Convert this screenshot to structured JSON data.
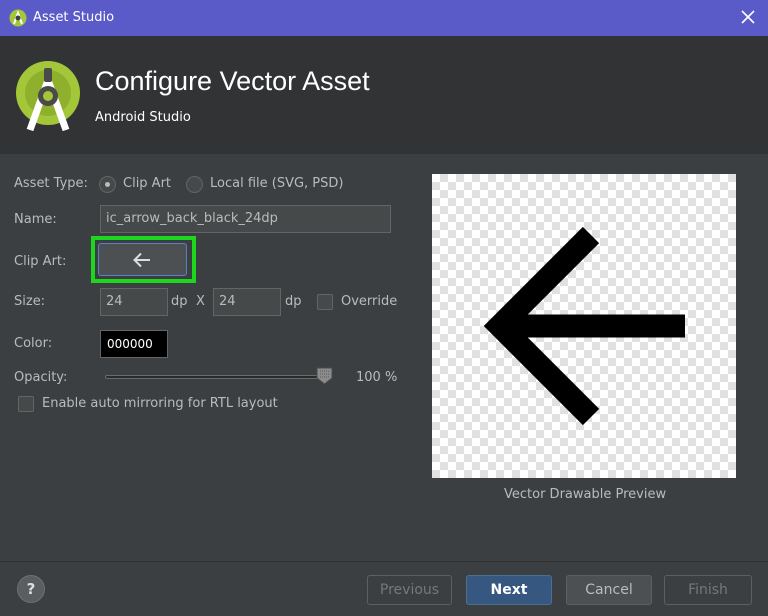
{
  "window": {
    "title": "Asset Studio"
  },
  "header": {
    "title": "Configure Vector Asset",
    "subtitle": "Android Studio"
  },
  "form": {
    "asset_type_label": "Asset Type:",
    "asset_type_options": [
      "Clip Art",
      "Local file (SVG, PSD)"
    ],
    "asset_type_selected": "Clip Art",
    "name_label": "Name:",
    "name_value": "ic_arrow_back_black_24dp",
    "clip_art_label": "Clip Art:",
    "clip_art_icon": "arrow-back-icon",
    "size_label": "Size:",
    "width_value": "24",
    "height_value": "24",
    "unit": "dp",
    "times": "X",
    "override_label": "Override",
    "override_checked": false,
    "color_label": "Color:",
    "color_value": "000000",
    "opacity_label": "Opacity:",
    "opacity_value": "100 %",
    "opacity_level": 1.0,
    "rtl_label": "Enable auto mirroring for RTL layout",
    "rtl_checked": false
  },
  "preview": {
    "caption": "Vector Drawable Preview",
    "icon": "arrow-back-icon"
  },
  "footer": {
    "help": "?",
    "previous": "Previous",
    "next": "Next",
    "cancel": "Cancel",
    "finish": "Finish"
  },
  "colors": {
    "titlebar": "#5a5ac8",
    "highlight": "#1ed61e",
    "primary_button": "#365880",
    "android_green": "#a4c639"
  }
}
